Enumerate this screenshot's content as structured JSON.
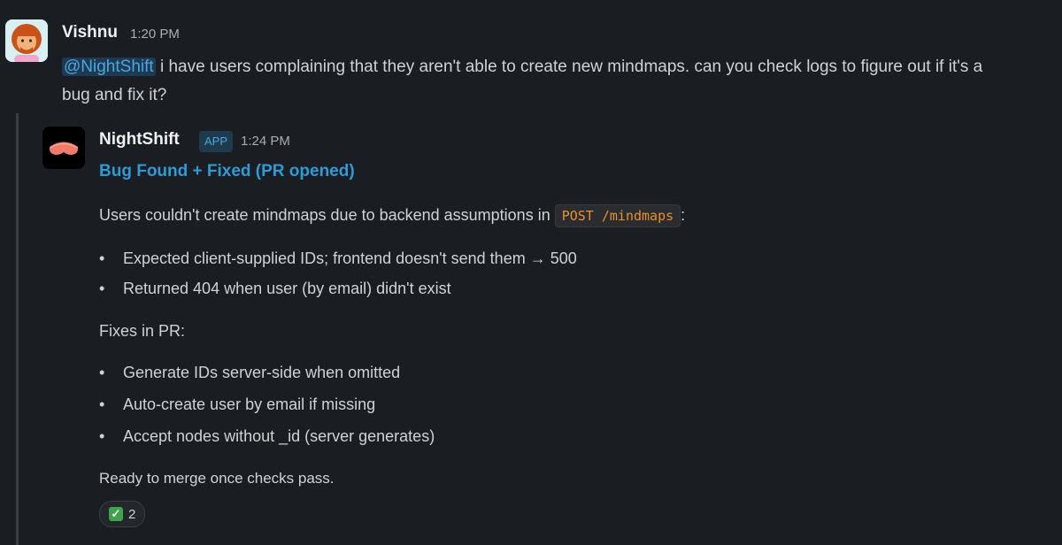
{
  "message": {
    "author": "Vishnu",
    "time": "1:20 PM",
    "mention": "@NightShift",
    "text_line1": " i have users complaining that they aren't able to create new mindmaps. can you check logs to figure out if it's a",
    "text_line2": "bug and fix it?"
  },
  "reply": {
    "author": "NightShift",
    "badge": "APP",
    "time": "1:24 PM",
    "title": "Bug Found + Fixed (PR opened)",
    "intro_before": "Users couldn't create mindmaps due to backend assumptions in ",
    "intro_code": "POST /mindmaps",
    "intro_after": ":",
    "causes": [
      "Expected client-supplied IDs; frontend doesn't send them → 500",
      "Returned 404 when user (by email) didn't exist"
    ],
    "fixes_heading": "Fixes in PR:",
    "fixes": [
      "Generate IDs server-side when omitted",
      "Auto-create user by email if missing",
      "Accept nodes without _id (server generates)"
    ],
    "closing": "Ready to merge once checks pass.",
    "reaction": {
      "icon": "white-check-mark-icon",
      "count": "2"
    }
  },
  "colors": {
    "background": "#1a1d21",
    "link": "#2e9ad6",
    "mention_bg": "#1d3a52",
    "code": "#e8912d",
    "reaction_check": "#3fa34d"
  }
}
